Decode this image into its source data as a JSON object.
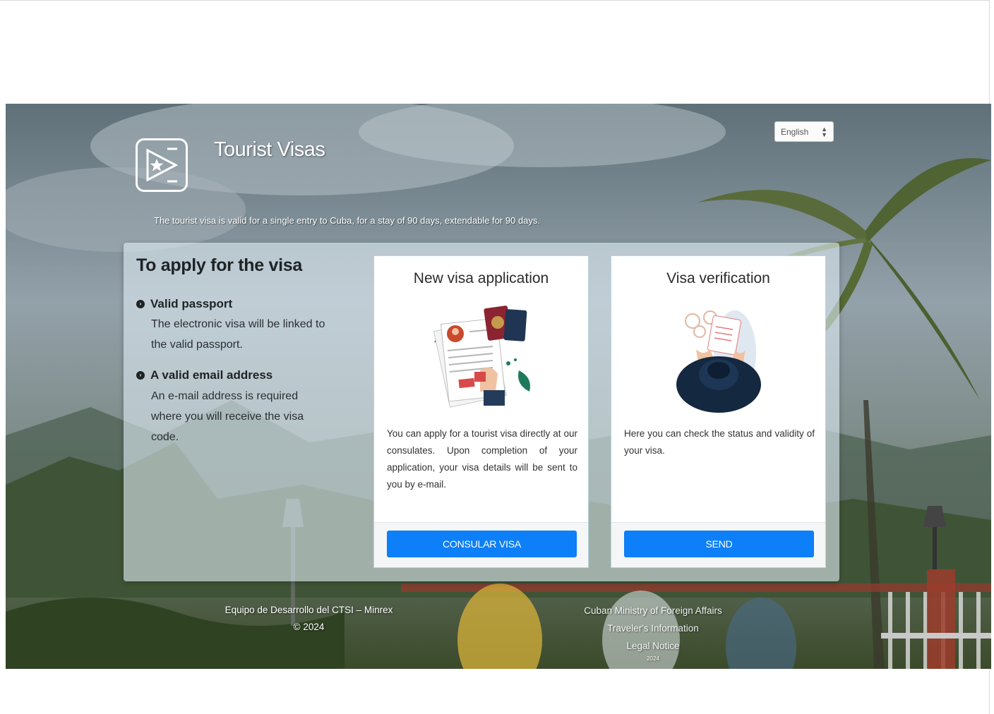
{
  "header": {
    "site_title": "Tourist Visas",
    "subtitle": "The tourist visa is valid for a single entry to Cuba, for a stay of 90 days, extendable for 90 days.",
    "language_selected": "English",
    "logo_icon": "star-play-icon"
  },
  "requirements": {
    "title": "To apply for the visa",
    "items": [
      {
        "title": "Valid passport",
        "desc_lines": [
          "The electronic visa will be linked to",
          "the valid passport."
        ]
      },
      {
        "title": "A valid email address",
        "desc_lines": [
          "An e-mail address is required",
          "where you will receive the visa",
          "code."
        ]
      }
    ]
  },
  "cards": [
    {
      "title": "New visa application",
      "text": "You can apply for a tourist visa directly at our consulates. Upon completion of your application, your visa details will be sent to you by e-mail.",
      "button_label": "CONSULAR VISA",
      "illustration": "passport-application-illustration"
    },
    {
      "title": "Visa verification",
      "text": "Here you can check the status and validity of your visa.",
      "button_label": "SEND",
      "illustration": "visa-check-illustration"
    }
  ],
  "footer": {
    "left_line1": "Equipo de Desarrollo del CTSI – Minrex",
    "left_line2": "© 2024",
    "right_line1": "Cuban Ministry of Foreign Affairs",
    "right_line2": "Traveler's Information",
    "right_line3": "Legal Notice",
    "right_line4": "2024"
  },
  "colors": {
    "primary_button": "#0d7ff8",
    "panel_bg": "rgba(220,232,240,0.62)"
  }
}
